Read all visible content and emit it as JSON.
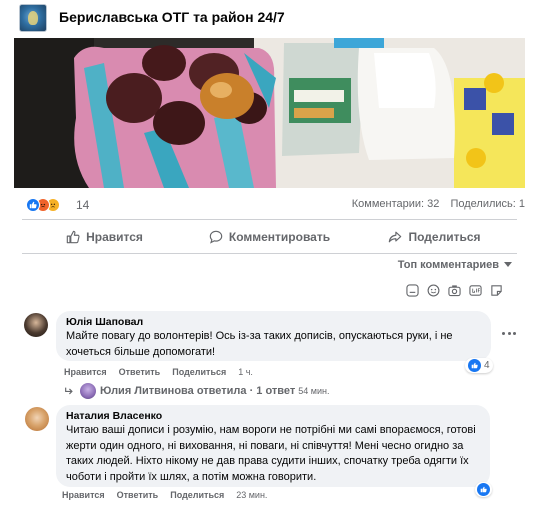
{
  "group": {
    "name": "Бериславська ОТГ та район 24/7"
  },
  "post": {
    "photo_icon": "groceries-photo",
    "reaction_count": "14",
    "comments_count": "Комментарии: 32",
    "shares_count": "Поделились: 1"
  },
  "actions": {
    "like": "Нравится",
    "comment": "Комментировать",
    "share": "Поделиться"
  },
  "sort_label": "Топ комментариев",
  "comments": [
    {
      "author": "Юлія Шаповал",
      "text": "Майте повагу до волонтерів! Ось із-за таких дописів, опускаються руки, і не хочеться більше допомогати!",
      "like": "Нравится",
      "reply": "Ответить",
      "share": "Поделиться",
      "time": "1 ч.",
      "reaction_count": "4",
      "reply_summary": "Юлия Литвинова ответила · 1 ответ",
      "reply_time": "54 мин."
    },
    {
      "author": "Наталия Власенко",
      "text": "Читаю ваші дописи і розумію, нам вороги не потрібні ми самі впораємося, готові жерти один одного, ні виховання, ні поваги, ні співчуття! Мені чесно огидно за таких людей. Ніхто нікому не дав права судити інших, спочатку треба одягти їх чоботи і пройти їх шлях, а потім можна говорити.",
      "like": "Нравится",
      "reply": "Ответить",
      "share": "Поделиться",
      "time": "23 мин."
    }
  ],
  "colors": {
    "brand_blue": "#1877f2",
    "secondary_text": "#65676b",
    "bubble_bg": "#f0f2f5"
  }
}
